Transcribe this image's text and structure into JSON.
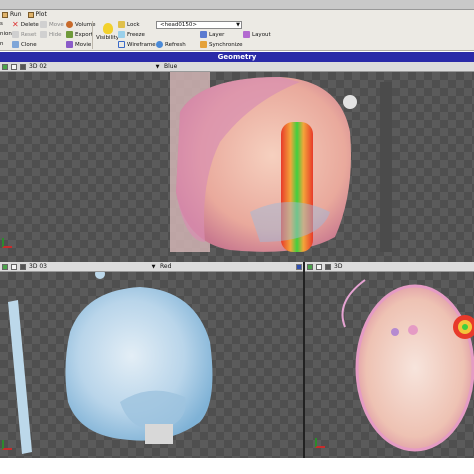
{
  "menu": {
    "items": [
      "Run",
      "Plot"
    ]
  },
  "toolbar": {
    "delete": "Delete",
    "reset": "Reset",
    "clone": "Clone",
    "hide": "Hide",
    "move": "Move",
    "volume": "Volume",
    "export": "Export",
    "movie": "Movie",
    "visibility": "Visibility",
    "lock": "Lock",
    "freeze": "Freeze",
    "wireframe": "Wireframe",
    "refresh": "Refresh",
    "layer": "Layer",
    "layout": "Layout",
    "synchronize": "Synchronize",
    "dataset_selected": "<head0150>",
    "left_labels": [
      "s",
      "nion",
      "n",
      "n"
    ]
  },
  "geometry_title": "Geometry",
  "views": [
    {
      "name": "3D 02",
      "color": "Blue"
    },
    {
      "name": "3D 03",
      "color": "Red"
    },
    {
      "name": "3D"
    }
  ],
  "colors": {
    "title_bar": "#2a2aa8",
    "beam": "#3fcf3f",
    "beam_edge": "#e83a2a"
  }
}
